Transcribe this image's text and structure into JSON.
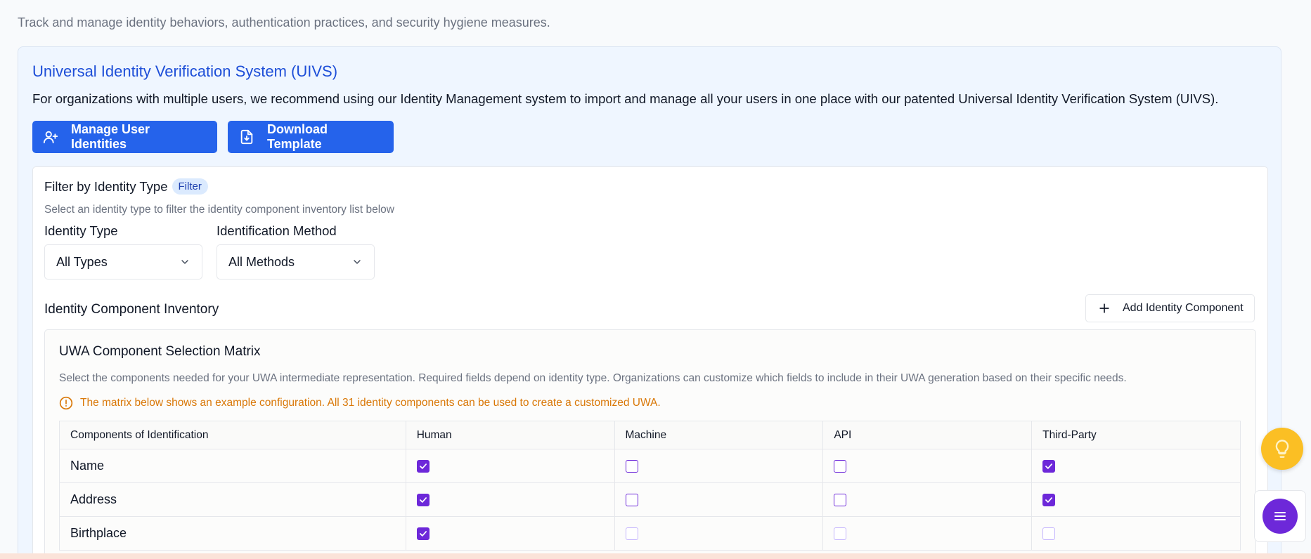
{
  "page": {
    "subtitle": "Track and manage identity behaviors, authentication practices, and security hygiene measures."
  },
  "uivs": {
    "title": "Universal Identity Verification System (UIVS)",
    "description": "For organizations with multiple users, we recommend using our Identity Management system to import and manage all your users in one place with our patented Universal Identity Verification System (UIVS).",
    "manage_button": "Manage User Identities",
    "download_button": "Download Template"
  },
  "filter": {
    "title": "Filter by Identity Type",
    "badge": "Filter",
    "hint": "Select an identity type to filter the identity component inventory list below",
    "identity_type_label": "Identity Type",
    "identity_type_value": "All Types",
    "method_label": "Identification Method",
    "method_value": "All Methods"
  },
  "inventory": {
    "title": "Identity Component Inventory",
    "add_button": "Add Identity Component"
  },
  "matrix": {
    "title": "UWA Component Selection Matrix",
    "description": "Select the components needed for your UWA intermediate representation. Required fields depend on identity type. Organizations can customize which fields to include in their UWA generation based on their specific needs.",
    "warning": "The matrix below shows an example configuration. All 31 identity components can be used to create a customized UWA.",
    "columns": [
      "Components of Identification",
      "Human",
      "Machine",
      "API",
      "Third-Party"
    ],
    "rows": [
      {
        "name": "Name",
        "checks": [
          true,
          false,
          false,
          true
        ],
        "muted": [
          false,
          false,
          false,
          false
        ]
      },
      {
        "name": "Address",
        "checks": [
          true,
          false,
          false,
          true
        ],
        "muted": [
          false,
          false,
          false,
          false
        ]
      },
      {
        "name": "Birthplace",
        "checks": [
          true,
          false,
          false,
          false
        ],
        "muted": [
          false,
          true,
          true,
          true
        ]
      }
    ]
  },
  "colors": {
    "primary": "#2563eb",
    "accent": "#6d28d9",
    "warning": "#d97706",
    "hint_fab": "#fbbf24"
  }
}
